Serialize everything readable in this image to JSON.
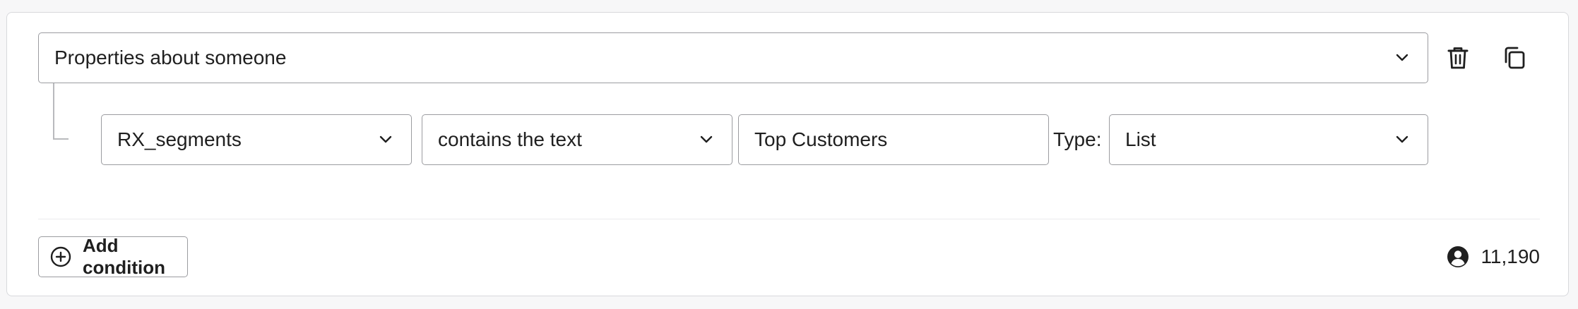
{
  "group": {
    "source_select": {
      "value": "Properties about someone"
    },
    "actions": {
      "delete_icon": "trash-icon",
      "duplicate_icon": "copy-icon"
    }
  },
  "condition": {
    "property_select": {
      "value": "RX_segments"
    },
    "operator_select": {
      "value": "contains the text"
    },
    "value_input": {
      "value": "Top Customers"
    },
    "type_label": "Type:",
    "type_select": {
      "value": "List"
    }
  },
  "footer": {
    "add_condition_label": "Add condition",
    "add_icon": "plus-circle-icon",
    "profile_count": "11,190",
    "profile_icon": "person-circle-icon"
  },
  "colors": {
    "border": "#9b9ca0",
    "card_border": "#d8d9dc",
    "text": "#1f1f1f",
    "background": "#f7f7f8"
  }
}
